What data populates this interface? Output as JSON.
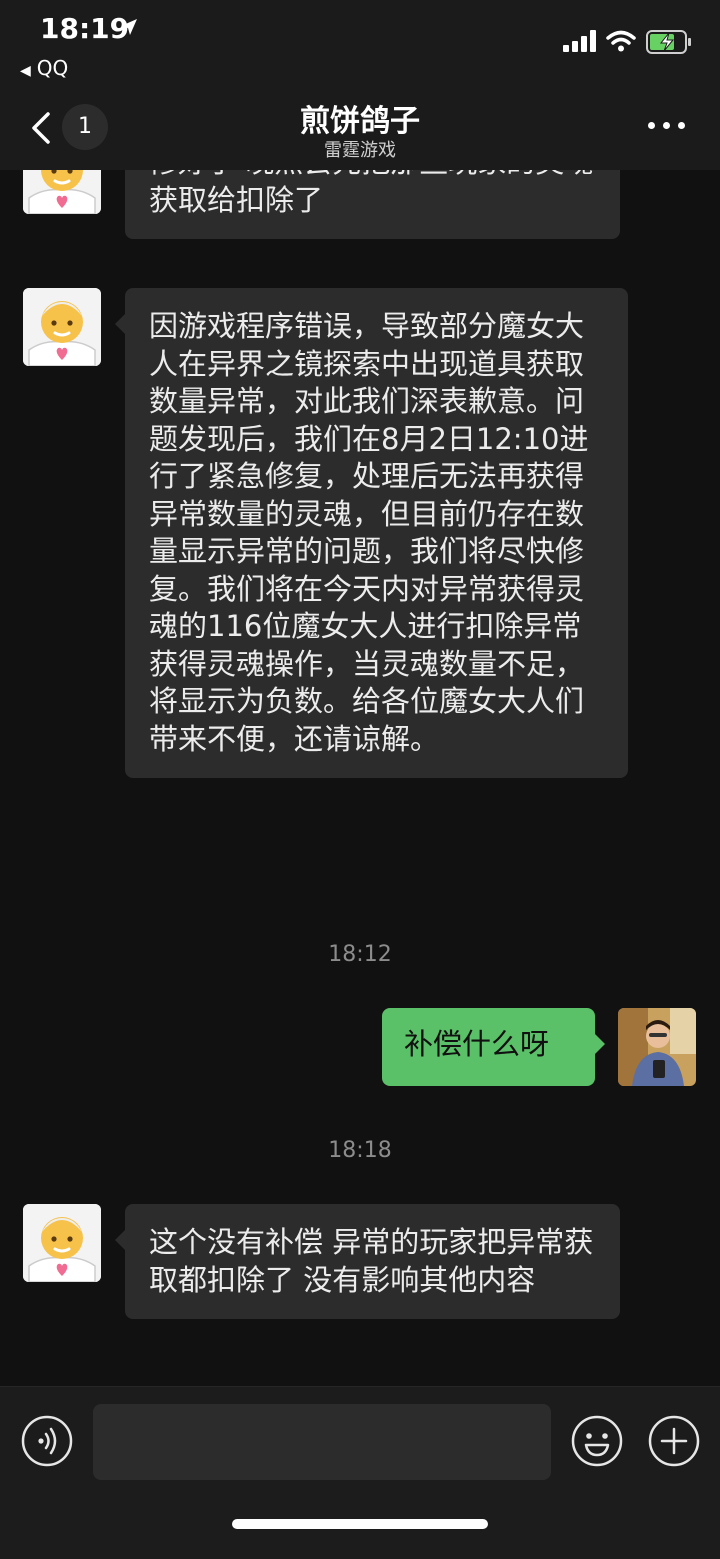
{
  "status_bar": {
    "time": "18:19",
    "back_app": "QQ",
    "icons": [
      "location-arrow-icon",
      "signal-icon",
      "wifi-icon",
      "battery-charging-icon"
    ]
  },
  "header": {
    "back_badge_count": "1",
    "title": "煎饼鸽子",
    "subtitle": "雷霆游戏"
  },
  "messages": [
    {
      "side": "left",
      "text": "修好了 晚点会先把那些玩家的灵魂获取给扣除了"
    },
    {
      "side": "left",
      "text": "因游戏程序错误，导致部分魔女大人在异界之镜探索中出现道具获取数量异常，对此我们深表歉意。问题发现后，我们在8月2日12:10进行了紧急修复，处理后无法再获得异常数量的灵魂，但目前仍存在数量显示异常的问题，我们将尽快修复。我们将在今天内对异常获得灵魂的116位魔女大人进行扣除异常获得灵魂操作，当灵魂数量不足，将显示为负数。给各位魔女大人们带来不便，还请谅解。"
    },
    {
      "type": "timestamp",
      "text": "18:12"
    },
    {
      "side": "right",
      "text": "补偿什么呀"
    },
    {
      "type": "timestamp",
      "text": "18:18"
    },
    {
      "side": "left",
      "text": "这个没有补偿 异常的玩家把异常获取都扣除了 没有影响其他内容"
    }
  ],
  "input_bar": {
    "placeholder": "",
    "icons": [
      "voice-icon",
      "emoji-icon",
      "plus-icon"
    ]
  },
  "colors": {
    "background": "#111111",
    "bubble_left": "#2c2c2c",
    "bubble_right": "#5ac168"
  }
}
